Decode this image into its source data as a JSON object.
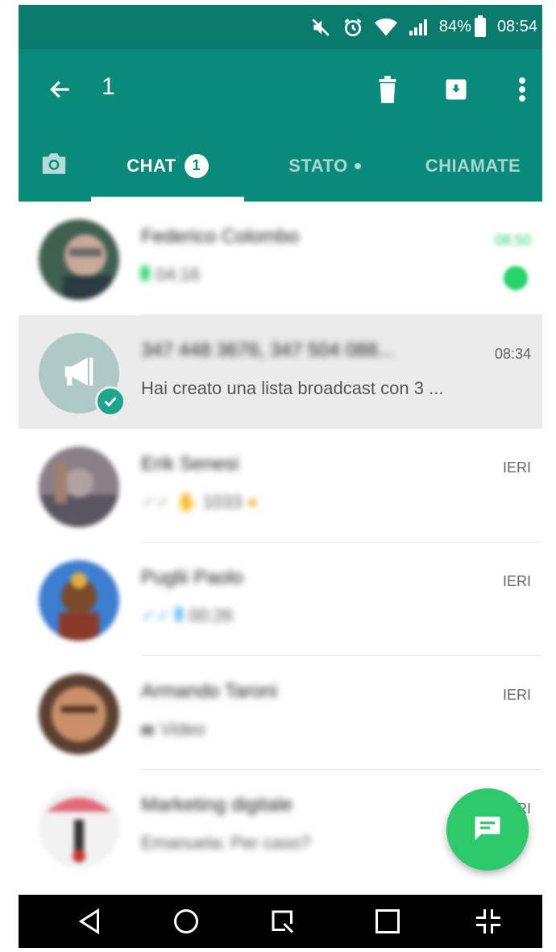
{
  "status_bar": {
    "battery_percent": "84%",
    "time": "08:54",
    "icons": [
      "mute-icon",
      "alarm-icon",
      "wifi-icon",
      "signal-icon",
      "battery-icon"
    ]
  },
  "app_bar": {
    "selected_count": "1",
    "actions": [
      "back-arrow-icon",
      "delete-icon",
      "archive-icon",
      "more-vert-icon"
    ]
  },
  "tabs": [
    {
      "label": "",
      "icon": "camera-icon"
    },
    {
      "label": "CHAT",
      "badge": "1",
      "active": true
    },
    {
      "label": "STATO",
      "dot": true
    },
    {
      "label": "CHIAMATE"
    }
  ],
  "chats": [
    {
      "name": "Federico Colombo",
      "preview": "04:16",
      "time": "08:50",
      "blurred": true,
      "unread": true
    },
    {
      "name": "347 448 3676, 347 504 088...",
      "preview": "Hai creato una lista broadcast con 3 ...",
      "time": "08:34",
      "blurred_name": true,
      "selected": true,
      "broadcast": true
    },
    {
      "name": "Erik Senesi",
      "preview": "1033",
      "time": "IERI",
      "blurred": true
    },
    {
      "name": "Puglii Paolo",
      "preview": "00:26",
      "time": "IERI",
      "blurred": true
    },
    {
      "name": "Armando Taroni",
      "preview": "Video",
      "time": "IERI",
      "blurred": true
    },
    {
      "name": "Marketing digitale",
      "preview": "Emanuela: Per caso?",
      "time": "IERI",
      "blurred": true
    }
  ],
  "colors": {
    "status_bar": "#0a7a6c",
    "app_bar": "#0a8a7a",
    "accent_green": "#25d366",
    "fab": "#2ec96a"
  },
  "fab": {
    "icon": "new-chat-icon"
  },
  "nav_bar": {
    "icons": [
      "back-triangle-icon",
      "home-circle-icon",
      "recents-icon",
      "square-icon",
      "collapse-icon"
    ]
  }
}
